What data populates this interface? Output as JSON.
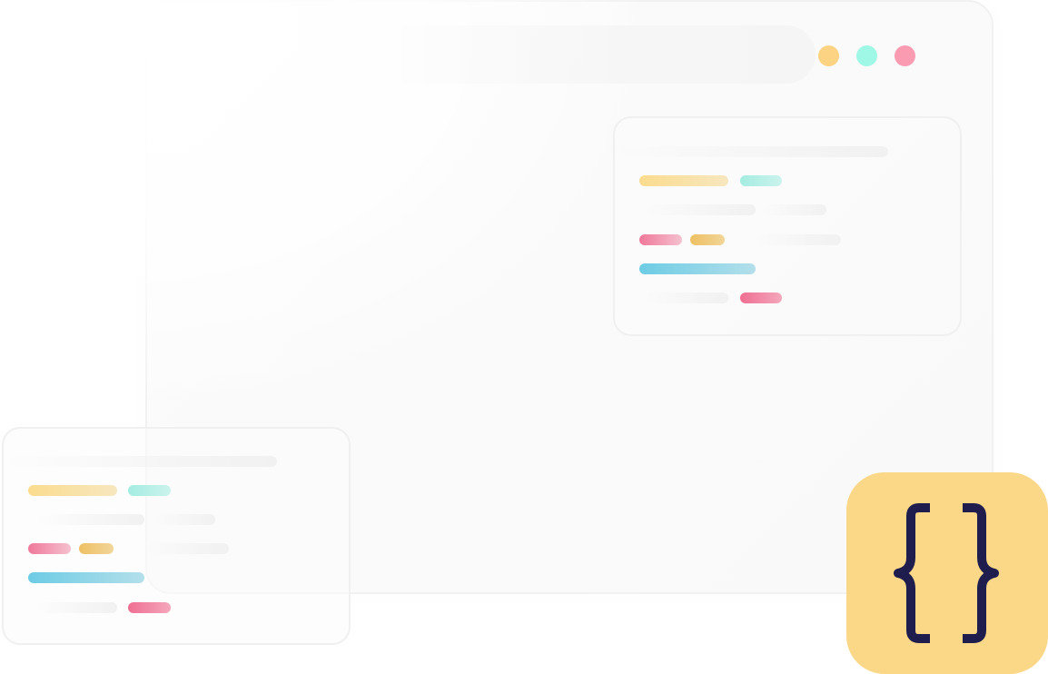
{
  "window": {
    "traffic_lights": [
      {
        "name": "minimize-dot",
        "color": "#fbd382"
      },
      {
        "name": "zoom-dot",
        "color": "#9ff7e6"
      },
      {
        "name": "close-dot",
        "color": "#fb9bb2"
      }
    ]
  },
  "colors": {
    "tile_background": "#fbd887",
    "brace_color": "#1f1d4e",
    "accent_yellow": "#fbdc8e",
    "accent_teal": "#a4ece1",
    "accent_pink": "#f0789a",
    "accent_gold": "#eec063",
    "accent_blue": "#6dcce5"
  },
  "icons": {
    "tile_icon": "curly-braces-icon"
  }
}
